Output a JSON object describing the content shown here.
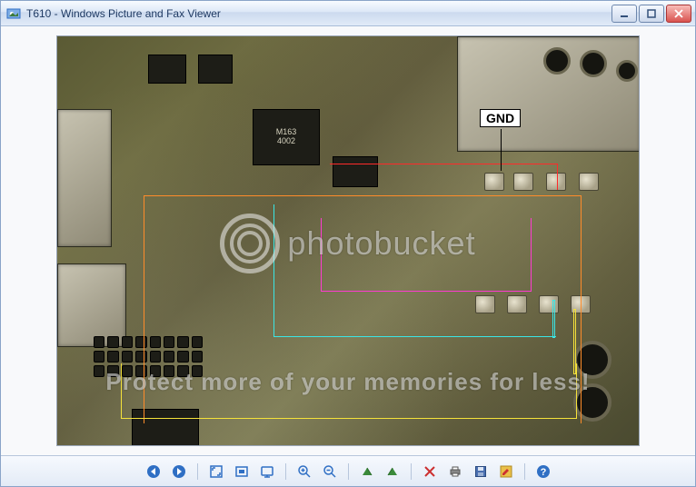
{
  "window": {
    "title": "T610 - Windows Picture and Fax Viewer"
  },
  "image": {
    "annotation_label": "GND",
    "chip_marking": "M163\n4002"
  },
  "watermark": {
    "brand": "photobucket",
    "tagline": "Protect more of your memories for less!"
  },
  "toolbar": {
    "items": [
      {
        "name": "first-icon",
        "tip": "Previous Image"
      },
      {
        "name": "last-icon",
        "tip": "Next Image"
      },
      {
        "name": "fit-icon",
        "tip": "Best Fit"
      },
      {
        "name": "actual-size-icon",
        "tip": "Actual Size"
      },
      {
        "name": "slideshow-icon",
        "tip": "Start Slide Show"
      },
      {
        "name": "zoom-in-icon",
        "tip": "Zoom In"
      },
      {
        "name": "zoom-out-icon",
        "tip": "Zoom Out"
      },
      {
        "name": "rotate-ccw-icon",
        "tip": "Rotate Counterclockwise"
      },
      {
        "name": "rotate-cw-icon",
        "tip": "Rotate Clockwise"
      },
      {
        "name": "delete-icon",
        "tip": "Delete"
      },
      {
        "name": "print-icon",
        "tip": "Print"
      },
      {
        "name": "save-icon",
        "tip": "Copy To"
      },
      {
        "name": "edit-icon",
        "tip": "Open for Editing"
      },
      {
        "name": "help-icon",
        "tip": "Help"
      }
    ]
  },
  "colors": {
    "accent": "#2f6fc4"
  }
}
